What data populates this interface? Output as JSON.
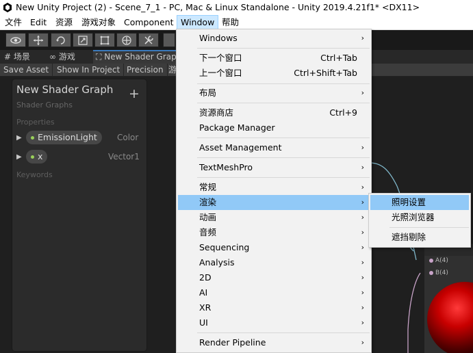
{
  "window": {
    "title": "New Unity Project (2) - Scene_7_1 - PC, Mac & Linux Standalone - Unity 2019.4.21f1* <DX11>"
  },
  "menubar": [
    "文件",
    "Edit",
    "资源",
    "游戏对象",
    "Component",
    "Window",
    "帮助"
  ],
  "toolbar": {
    "tools": [
      "view-tool",
      "move-tool",
      "rotate-tool",
      "scale-tool",
      "rect-tool",
      "transform-tool",
      "custom-tool"
    ]
  },
  "tabs": [
    "场景",
    "游戏",
    "New Shader Grap"
  ],
  "shader_toolbar": [
    "Save Asset",
    "Show In Project",
    "Precision",
    "游"
  ],
  "blackboard": {
    "title": "New Shader Graph",
    "subtitle": "Shader Graphs",
    "add": "+",
    "properties_label": "Properties",
    "properties": [
      {
        "name": "EmissionLight",
        "type": "Color",
        "dot": "#9ad05a"
      },
      {
        "name": "x",
        "type": "Vector1",
        "dot": "#9ad05a"
      }
    ],
    "keywords_label": "Keywords"
  },
  "node": {
    "ports": [
      "A(4)",
      "B(4)"
    ],
    "sub_label": "A(4)"
  },
  "window_menu": {
    "items": [
      {
        "label": "Windows",
        "submenu": true
      },
      {
        "separator": true
      },
      {
        "label": "下一个窗口",
        "shortcut": "Ctrl+Tab"
      },
      {
        "label": "上一个窗口",
        "shortcut": "Ctrl+Shift+Tab"
      },
      {
        "separator": true
      },
      {
        "label": "布局",
        "submenu": true
      },
      {
        "separator": true
      },
      {
        "label": "资源商店",
        "shortcut": "Ctrl+9"
      },
      {
        "label": "Package Manager"
      },
      {
        "separator": true
      },
      {
        "label": "Asset Management",
        "submenu": true
      },
      {
        "separator": true
      },
      {
        "label": "TextMeshPro",
        "submenu": true
      },
      {
        "separator": true
      },
      {
        "label": "常规",
        "submenu": true
      },
      {
        "label": "渲染",
        "submenu": true,
        "highlighted": true
      },
      {
        "label": "动画",
        "submenu": true
      },
      {
        "label": "音频",
        "submenu": true
      },
      {
        "label": "Sequencing",
        "submenu": true
      },
      {
        "label": "Analysis",
        "submenu": true
      },
      {
        "label": "2D",
        "submenu": true
      },
      {
        "label": "AI",
        "submenu": true
      },
      {
        "label": "XR",
        "submenu": true
      },
      {
        "label": "UI",
        "submenu": true
      },
      {
        "separator": true
      },
      {
        "label": "Render Pipeline",
        "submenu": true
      }
    ]
  },
  "render_submenu": {
    "items": [
      {
        "label": "照明设置",
        "highlighted": true
      },
      {
        "label": "光照浏览器"
      },
      {
        "separator": true
      },
      {
        "label": "遮挡剔除"
      }
    ]
  },
  "colors": {
    "menu_highlight": "#91c9f7",
    "edge": "#7fb6c9",
    "edge_pink": "#c8a3c8"
  }
}
